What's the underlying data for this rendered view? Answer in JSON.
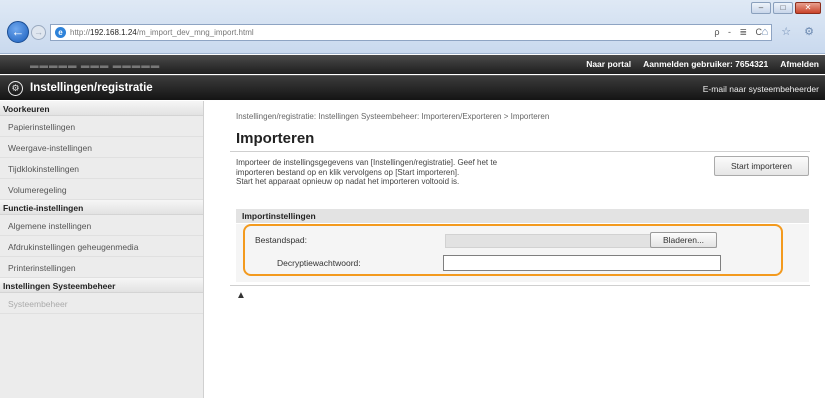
{
  "browser": {
    "url_prefix": "http://",
    "url_host": "192.168.1.24",
    "url_path": "/m_import_dev_mng_import.html",
    "address_tools": "ρ - ≣ C",
    "icons": "⌂ ☆ ⚙"
  },
  "header": {
    "top_links": [
      "Naar portal",
      "Aanmelden gebruiker:  7654321",
      "Afmelden"
    ],
    "title": "Instellingen/registratie",
    "admin_mail": "E-mail naar systeembeheerder"
  },
  "sidebar": {
    "sections": [
      {
        "heading": "Voorkeuren",
        "items": [
          "Papierinstellingen",
          "Weergave-instellingen",
          "Tijdklokinstellingen",
          "Volumeregeling"
        ]
      },
      {
        "heading": "Functie-instellingen",
        "items": [
          "Algemene instellingen",
          "Afdrukinstellingen geheugenmedia",
          "Printerinstellingen"
        ]
      },
      {
        "heading": "Instellingen Systeembeheer",
        "items": [
          "Systeembeheer"
        ]
      }
    ]
  },
  "main": {
    "breadcrumb": "Instellingen/registratie: Instellingen Systeembeheer: Importeren/Exporteren > Importeren",
    "title": "Importeren",
    "description": [
      "Importeer de instellingsgegevens van [Instellingen/registratie]. Geef het te",
      "importeren bestand op en klik vervolgens op [Start importeren].",
      "Start het apparaat opnieuw op nadat het importeren voltooid is."
    ],
    "start_button": "Start importeren",
    "section_title": "Importinstellingen",
    "file_label": "Bestandspad:",
    "browse_button": "Bladeren...",
    "password_label": "Decryptiewachtwoord:",
    "password_value": "",
    "top_link": "▲"
  },
  "colors": {
    "highlight": "#f39a1e",
    "header_dark": "#1e1e1e"
  }
}
